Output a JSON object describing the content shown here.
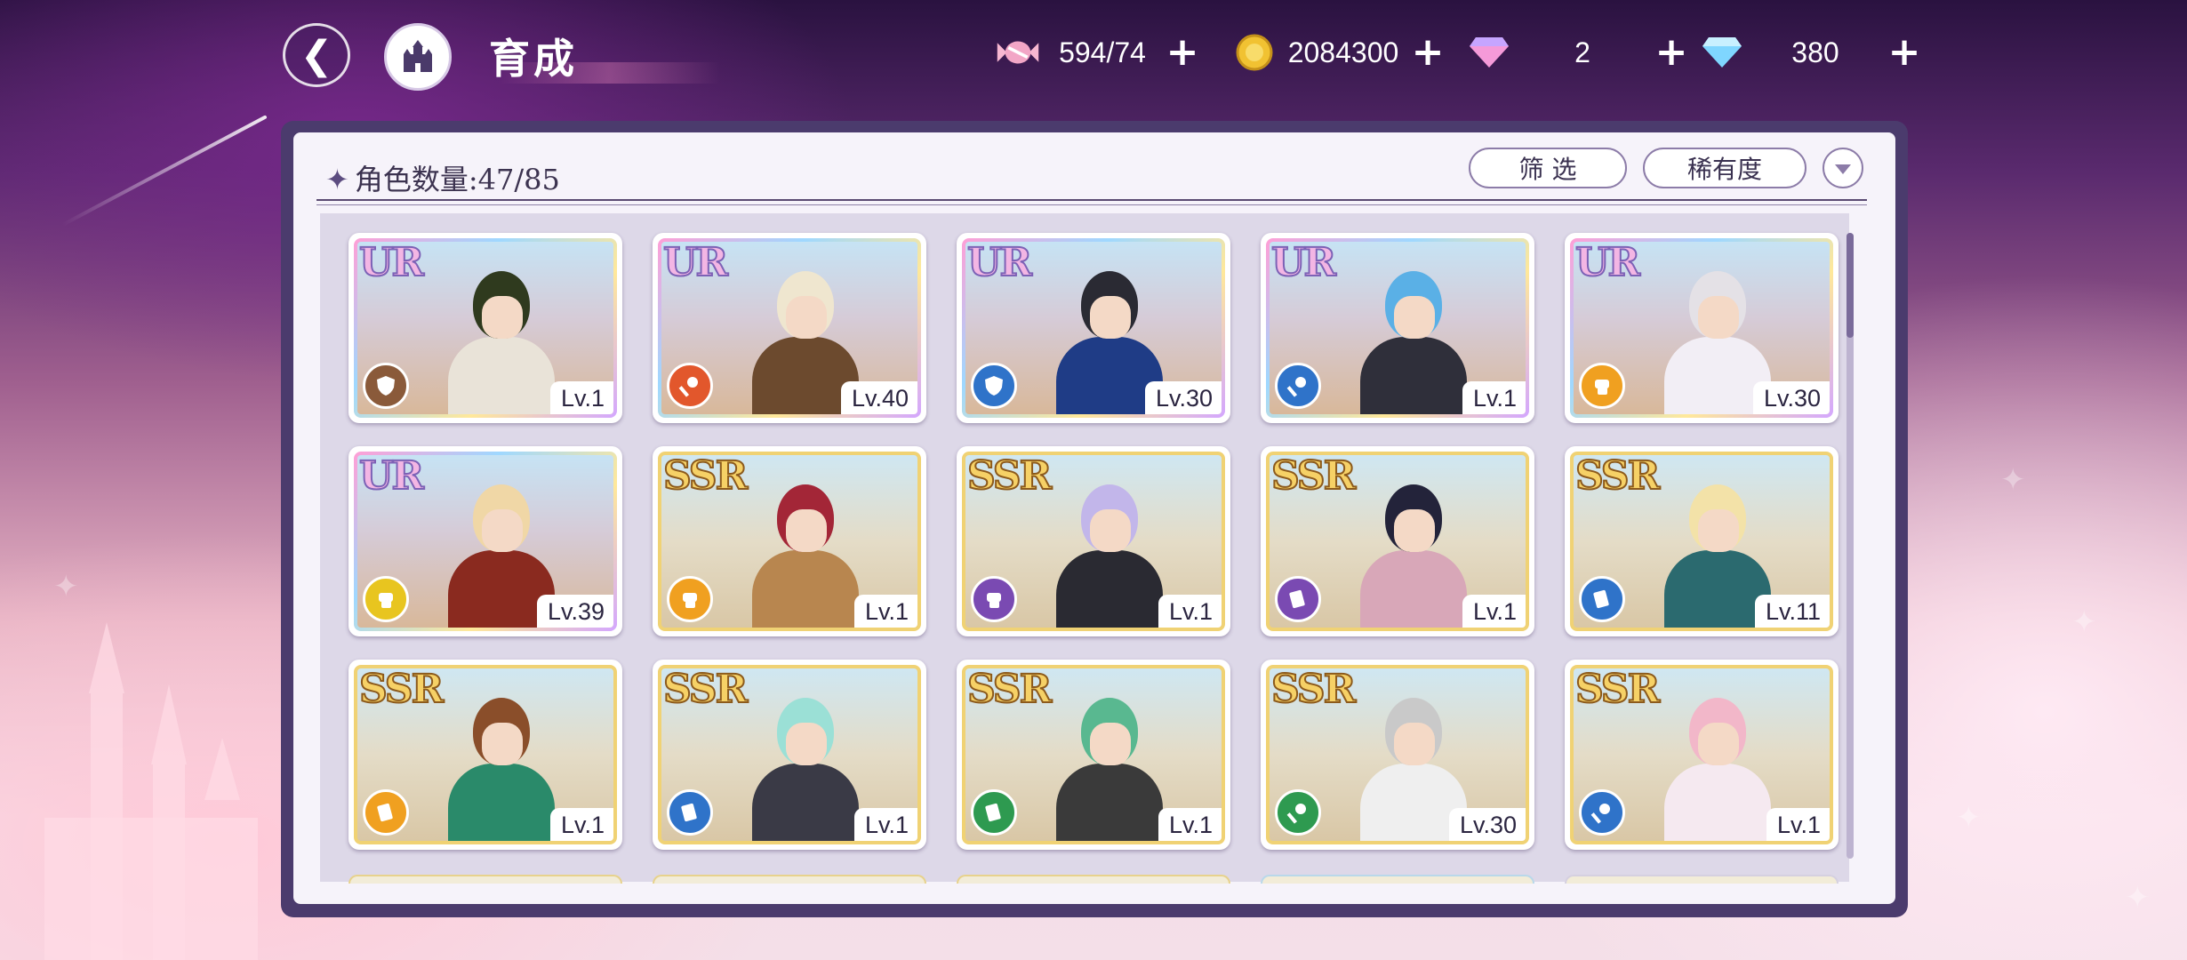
{
  "header": {
    "back_icon": "back-arrow-icon",
    "home_icon": "castle-home-icon",
    "title": "育成"
  },
  "resources": [
    {
      "icon": "candy-icon",
      "value": "594/74",
      "color": "#f2a6c6"
    },
    {
      "icon": "gold-coin-icon",
      "value": "2084300",
      "color": "#f1c232"
    },
    {
      "icon": "pink-gem-icon",
      "value": "2",
      "color": "#f59ad9"
    },
    {
      "icon": "blue-diamond-icon",
      "value": "380",
      "color": "#7fd6ff"
    }
  ],
  "panel": {
    "count_label": "角色数量:",
    "count_value": "47/85",
    "filter_label": "筛 选",
    "sort_label": "稀有度"
  },
  "characters": [
    {
      "rarity": "UR",
      "level": "Lv.1",
      "attr_icon": "shield-icon",
      "attr_color": "#8a5a3a",
      "hair": "#2f3a1e",
      "outfit": "#e9e3d8"
    },
    {
      "rarity": "UR",
      "level": "Lv.40",
      "attr_icon": "scepter-icon",
      "attr_color": "#e2572c",
      "hair": "#efe6cf",
      "outfit": "#6c4a2e"
    },
    {
      "rarity": "UR",
      "level": "Lv.30",
      "attr_icon": "shield-icon",
      "attr_color": "#2f73c9",
      "hair": "#2a2a33",
      "outfit": "#1f3c86"
    },
    {
      "rarity": "UR",
      "level": "Lv.1",
      "attr_icon": "scepter-icon",
      "attr_color": "#2f73c9",
      "hair": "#5ab0e6",
      "outfit": "#2f2f3a"
    },
    {
      "rarity": "UR",
      "level": "Lv.30",
      "attr_icon": "fist-icon",
      "attr_color": "#f0a020",
      "hair": "#e4e1e6",
      "outfit": "#f2eef5"
    },
    {
      "rarity": "UR",
      "level": "Lv.39",
      "attr_icon": "fist-icon",
      "attr_color": "#e8c51f",
      "hair": "#f0d7a6",
      "outfit": "#8a2a1f"
    },
    {
      "rarity": "SSR",
      "level": "Lv.1",
      "attr_icon": "fist-icon",
      "attr_color": "#f0a020",
      "hair": "#a32637",
      "outfit": "#b8864f"
    },
    {
      "rarity": "SSR",
      "level": "Lv.1",
      "attr_icon": "fist-icon",
      "attr_color": "#7a4ab2",
      "hair": "#c2b6ea",
      "outfit": "#2a2a32"
    },
    {
      "rarity": "SSR",
      "level": "Lv.1",
      "attr_icon": "book-icon",
      "attr_color": "#7a4ab2",
      "hair": "#23233a",
      "outfit": "#d8a7b8"
    },
    {
      "rarity": "SSR",
      "level": "Lv.11",
      "attr_icon": "book-icon",
      "attr_color": "#2f73c9",
      "hair": "#f3e2a8",
      "outfit": "#2b6a6f"
    },
    {
      "rarity": "SSR",
      "level": "Lv.1",
      "attr_icon": "book-icon",
      "attr_color": "#f0a020",
      "hair": "#8a4e2a",
      "outfit": "#2a8a6a"
    },
    {
      "rarity": "SSR",
      "level": "Lv.1",
      "attr_icon": "book-icon",
      "attr_color": "#2f73c9",
      "hair": "#9be0d6",
      "outfit": "#3a3a46"
    },
    {
      "rarity": "SSR",
      "level": "Lv.1",
      "attr_icon": "book-icon",
      "attr_color": "#2e9a50",
      "hair": "#59b890",
      "outfit": "#3a3a3a"
    },
    {
      "rarity": "SSR",
      "level": "Lv.30",
      "attr_icon": "scepter-icon",
      "attr_color": "#2e9a50",
      "hair": "#c9c9c9",
      "outfit": "#efefef"
    },
    {
      "rarity": "SSR",
      "level": "Lv.1",
      "attr_icon": "scepter-icon",
      "attr_color": "#2f73c9",
      "hair": "#f2b7c9",
      "outfit": "#f5e9f0"
    }
  ],
  "colors": {
    "frame": "#4b3b6d",
    "panel": "#f6f3fa",
    "ur_border": "#d3a6ff",
    "ssr_border": "#f0d274"
  }
}
